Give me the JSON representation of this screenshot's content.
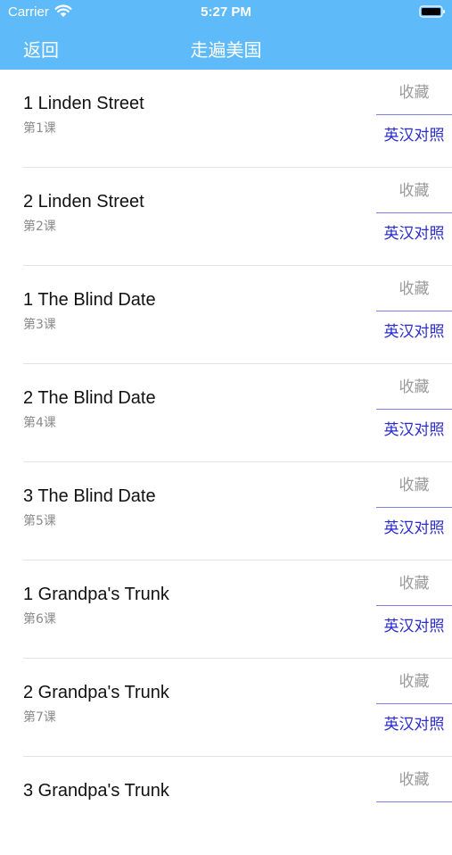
{
  "status_bar": {
    "carrier": "Carrier",
    "time": "5:27 PM"
  },
  "nav": {
    "back_label": "返回",
    "title": "走遍美国"
  },
  "colors": {
    "header_bg": "#5fbaf9",
    "favorite_text": "#9a9a9a",
    "bilingual_text": "#2a2ad1"
  },
  "lessons": [
    {
      "title": "1 Linden Street",
      "subtitle": "第1课",
      "favorite_label": "收藏",
      "bilingual_label": "英汉对照"
    },
    {
      "title": "2 Linden Street",
      "subtitle": "第2课",
      "favorite_label": "收藏",
      "bilingual_label": "英汉对照"
    },
    {
      "title": "1 The Blind Date",
      "subtitle": "第3课",
      "favorite_label": "收藏",
      "bilingual_label": "英汉对照"
    },
    {
      "title": "2 The Blind Date",
      "subtitle": "第4课",
      "favorite_label": "收藏",
      "bilingual_label": "英汉对照"
    },
    {
      "title": "3 The Blind Date",
      "subtitle": "第5课",
      "favorite_label": "收藏",
      "bilingual_label": "英汉对照"
    },
    {
      "title": "1 Grandpa's Trunk",
      "subtitle": "第6课",
      "favorite_label": "收藏",
      "bilingual_label": "英汉对照"
    },
    {
      "title": "2 Grandpa's Trunk",
      "subtitle": "第7课",
      "favorite_label": "收藏",
      "bilingual_label": "英汉对照"
    },
    {
      "title": "3 Grandpa's Trunk",
      "subtitle": "",
      "favorite_label": "收藏",
      "bilingual_label": ""
    }
  ]
}
